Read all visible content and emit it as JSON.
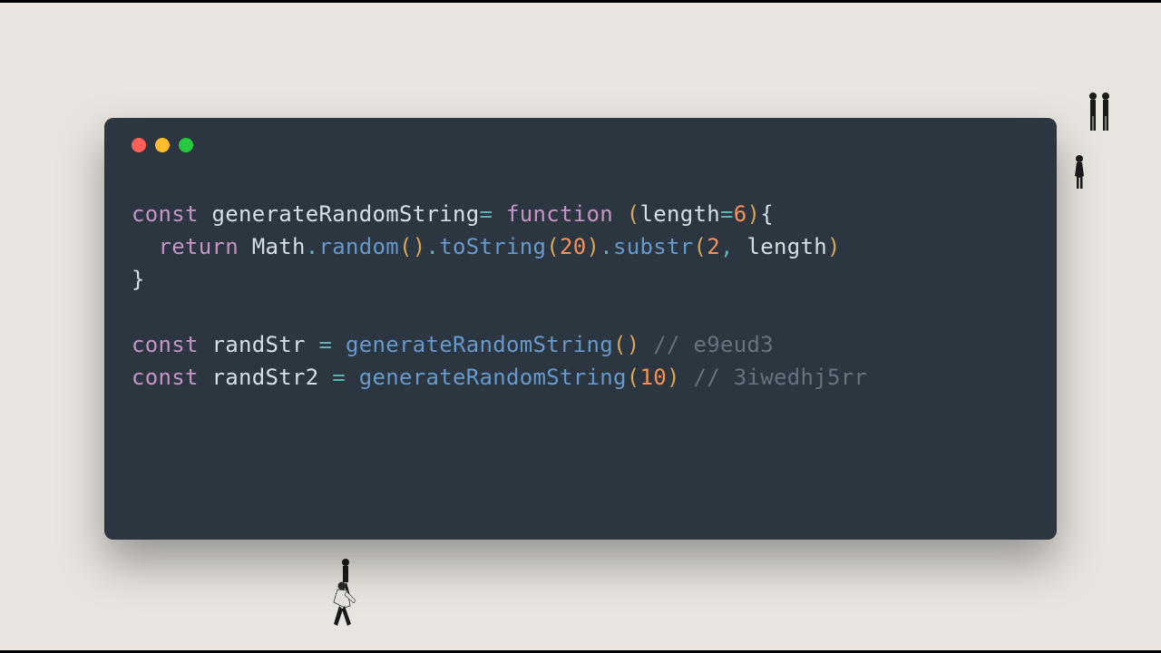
{
  "window": {
    "controls": {
      "close_color": "#ff5f56",
      "minimize_color": "#ffbd2e",
      "zoom_color": "#27c93f"
    }
  },
  "code": {
    "line1": {
      "kw_const": "const",
      "name": "generateRandomString",
      "eq": "=",
      "kw_function": "function",
      "paren_open": "(",
      "param": "length",
      "param_eq": "=",
      "default_val": "6",
      "paren_close": ")",
      "brace_open": "{"
    },
    "line2": {
      "indent": "  ",
      "kw_return": "return",
      "obj": "Math",
      "dot1": ".",
      "m1": "random",
      "p1o": "(",
      "p1c": ")",
      "dot2": ".",
      "m2": "toString",
      "p2o": "(",
      "arg20": "20",
      "p2c": ")",
      "dot3": ".",
      "m3": "substr",
      "p3o": "(",
      "arg2": "2",
      "comma": ",",
      "argLen": "length",
      "p3c": ")"
    },
    "line3": {
      "brace_close": "}"
    },
    "line5": {
      "kw_const": "const",
      "name": "randStr",
      "eq": "=",
      "call": "generateRandomString",
      "po": "(",
      "pc": ")",
      "comment": "// e9eud3"
    },
    "line6": {
      "kw_const": "const",
      "name": "randStr2",
      "eq": "=",
      "call": "generateRandomString",
      "po": "(",
      "arg": "10",
      "pc": ")",
      "comment": "// 3iwedhj5rr"
    }
  }
}
